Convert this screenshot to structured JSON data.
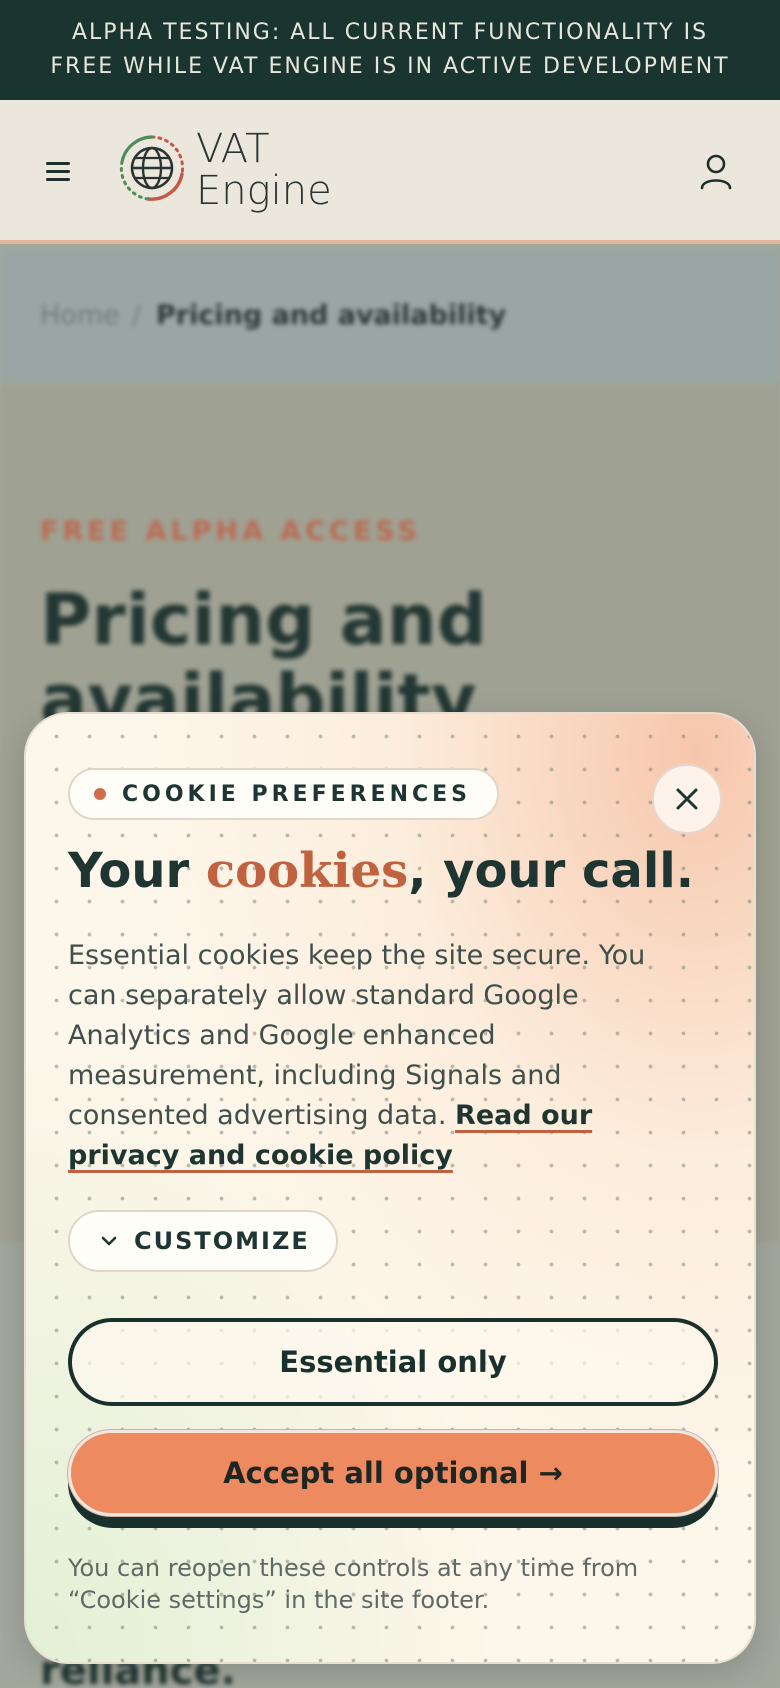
{
  "alpha_banner": {
    "text": "ALPHA TESTING: ALL CURRENT FUNCTIONALITY IS FREE WHILE VAT ENGINE IS IN ACTIVE DEVELOPMENT"
  },
  "header": {
    "menu_icon": "hamburger-menu-icon",
    "logo_line1": "VAT",
    "logo_line2": "Engine",
    "account_icon": "user-icon"
  },
  "breadcrumb": {
    "home": "Home",
    "separator": "/",
    "current": "Pricing and availability"
  },
  "hero": {
    "eyebrow": "FREE ALPHA ACCESS",
    "title": "Pricing and availability"
  },
  "lower": {
    "text_fragment": "reliance."
  },
  "cookie_modal": {
    "pill_label": "COOKIE PREFERENCES",
    "title_before": "Your ",
    "title_accent": "cookies",
    "title_after": ", your call.",
    "body": "Essential cookies keep the site secure. You can separately allow standard Google Analytics and Google enhanced measurement, including Signals and consented advertising data. ",
    "policy_link": "Read our privacy and cookie policy",
    "customize_label": "CUSTOMIZE",
    "essential_label": "Essential only",
    "accept_label": "Accept all optional →",
    "footnote": "You can reopen these controls at any time from “Cookie settings” in the site footer.",
    "close_icon": "close-icon"
  },
  "colors": {
    "banner_bg": "#1a3530",
    "accent": "#c0623f",
    "accept_bg": "#ee8a5f",
    "dark": "#1a302c"
  }
}
